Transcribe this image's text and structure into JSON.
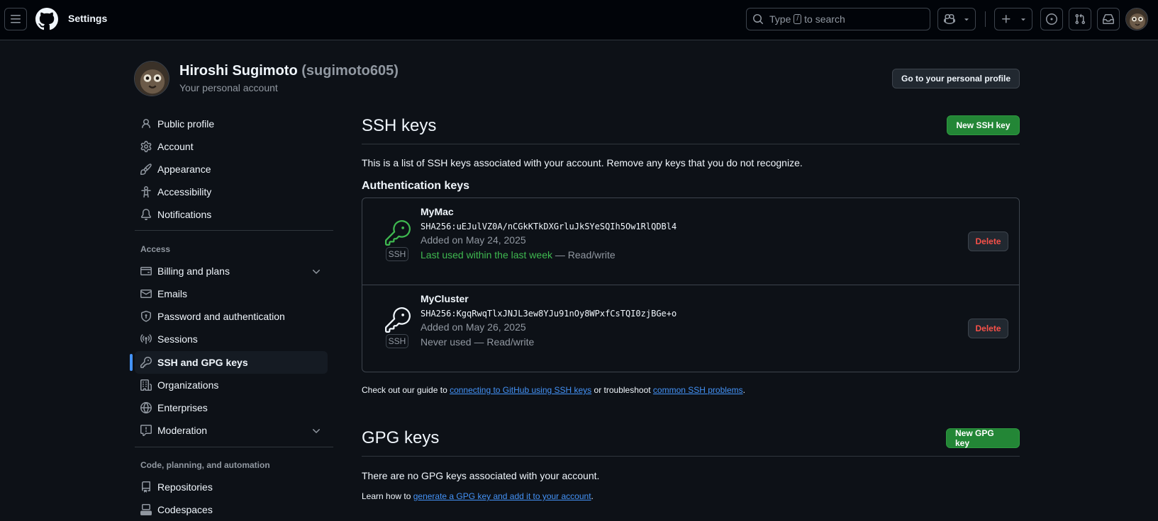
{
  "header": {
    "title": "Settings",
    "search_type": "Type",
    "search_key": "/",
    "search_rest": "to search"
  },
  "profile": {
    "name": "Hiroshi Sugimoto",
    "handle": "(sugimoto605)",
    "subtitle": "Your personal account",
    "profile_button": "Go to your personal profile"
  },
  "sidebar": {
    "top_items": [
      {
        "label": "Public profile",
        "icon": "person-icon"
      },
      {
        "label": "Account",
        "icon": "gear-icon"
      },
      {
        "label": "Appearance",
        "icon": "paintbrush-icon"
      },
      {
        "label": "Accessibility",
        "icon": "accessibility-icon"
      },
      {
        "label": "Notifications",
        "icon": "bell-icon"
      }
    ],
    "access_label": "Access",
    "access_items": [
      {
        "label": "Billing and plans",
        "icon": "credit-card-icon"
      },
      {
        "label": "Emails",
        "icon": "mail-icon"
      },
      {
        "label": "Password and authentication",
        "icon": "shield-lock-icon"
      },
      {
        "label": "Sessions",
        "icon": "broadcast-icon"
      },
      {
        "label": "SSH and GPG keys",
        "icon": "key-icon"
      },
      {
        "label": "Organizations",
        "icon": "organization-icon"
      },
      {
        "label": "Enterprises",
        "icon": "globe-icon"
      },
      {
        "label": "Moderation",
        "icon": "report-icon"
      }
    ],
    "code_label": "Code, planning, and automation",
    "code_items": [
      {
        "label": "Repositories",
        "icon": "repo-icon"
      },
      {
        "label": "Codespaces",
        "icon": "codespaces-icon"
      }
    ]
  },
  "ssh": {
    "title": "SSH keys",
    "new_button": "New SSH key",
    "description": "This is a list of SSH keys associated with your account. Remove any keys that you do not recognize.",
    "auth_title": "Authentication keys",
    "badge": "SSH",
    "delete_label": "Delete",
    "keys": [
      {
        "name": "MyMac",
        "fingerprint": "SHA256:uEJulVZ0A/nCGkKTkDXGrluJkSYeSQIh5Ow1RlQDBl4",
        "added": "Added on May 24, 2025",
        "used": "Last used within the last week",
        "access": " — Read/write"
      },
      {
        "name": "MyCluster",
        "fingerprint": "SHA256:KgqRwqTlxJNJL3ew8YJu91nOy8WPxfCsTQI0zjBGe+o",
        "added": "Added on May 26, 2025",
        "used": "Never used",
        "access": " — Read/write"
      }
    ],
    "guide_prefix": "Check out our guide to ",
    "guide_link1": "connecting to GitHub using SSH keys",
    "guide_middle": " or troubleshoot ",
    "guide_link2": "common SSH problems",
    "guide_suffix": "."
  },
  "gpg": {
    "title": "GPG keys",
    "new_button": "New GPG key",
    "empty": "There are no GPG keys associated with your account.",
    "learn_prefix": "Learn how to ",
    "learn_link": "generate a GPG key and add it to your account",
    "learn_suffix": "."
  },
  "colors": {
    "background": "#0d1117",
    "accent": "#4493f8",
    "primary_button": "#238636",
    "danger": "#f85149",
    "key_active": "#3fb950"
  }
}
